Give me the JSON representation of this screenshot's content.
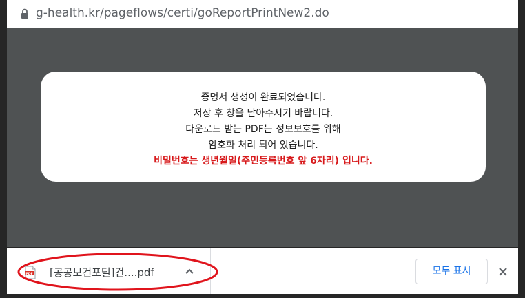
{
  "address_bar": {
    "url": "g-health.kr/pageflows/certi/goReportPrintNew2.do",
    "lock_icon": "lock-icon"
  },
  "dialog": {
    "lines": [
      "증명서 생성이 완료되었습니다.",
      "저장 후 창을 닫아주시기 바랍니다.",
      "다운로드 받는 PDF는 정보보호를 위해",
      "암호화 처리 되어 있습니다."
    ],
    "warning": "비밀번호는 생년월일(주민등록번호 앞 6자리) 입니다.",
    "warning_color": "#d7191b"
  },
  "download_shelf": {
    "file_name": "[공공보건포털]건....pdf",
    "file_icon": "pdf-file-icon",
    "show_all_label": "모두 표시",
    "close_icon": "close-icon",
    "accent_color": "#1a73e8",
    "highlight_color": "#e0141c"
  }
}
